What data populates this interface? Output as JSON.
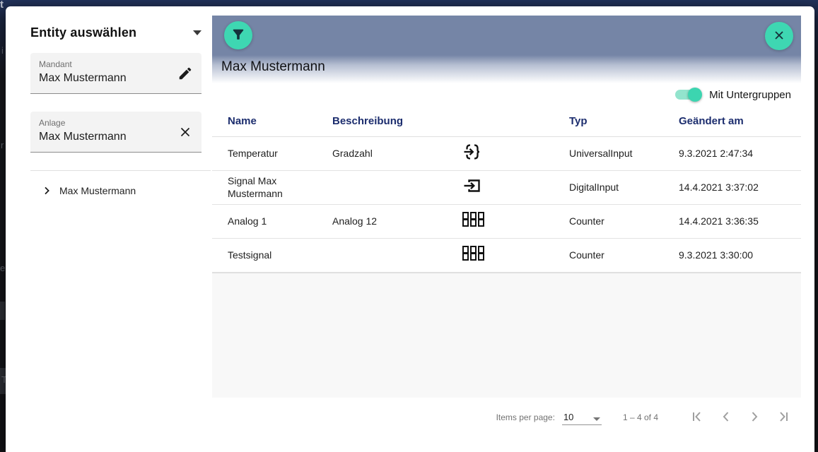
{
  "background_fragments": [
    "t",
    "i",
    "r",
    "el",
    "T"
  ],
  "colors": {
    "accent_teal": "#3ed7b2",
    "header_bar": "#7585a6",
    "table_header_text": "#1c2d6e",
    "overlay_background": "#15161a"
  },
  "sidebar": {
    "title": "Entity auswählen",
    "collapse_icon": "caret-down-icon",
    "fields": [
      {
        "label": "Mandant",
        "value": "Max Mustermann",
        "action_icon": "edit-pencil-icon"
      },
      {
        "label": "Anlage",
        "value": "Max Mustermann",
        "action_icon": "clear-x-icon"
      }
    ],
    "tree": [
      {
        "label": "Max Mustermann",
        "expand_icon": "chevron-right-icon"
      }
    ]
  },
  "main": {
    "filter_button_icon": "funnel-icon",
    "close_button_icon": "x-icon",
    "title": "Max Mustermann",
    "toggle": {
      "label": "Mit Untergruppen",
      "state": "on"
    },
    "table": {
      "columns": [
        "Name",
        "Beschreibung",
        "",
        "Typ",
        "Geändert am"
      ],
      "rows": [
        {
          "name": "Temperatur",
          "description": "Gradzahl",
          "icon": "input-braces-icon",
          "typ": "UniversalInput",
          "changed": "9.3.2021 2:47:34"
        },
        {
          "name": "Signal Max Mustermann",
          "description": "",
          "icon": "input-box-icon",
          "typ": "DigitalInput",
          "changed": "14.4.2021 3:37:02"
        },
        {
          "name": "Analog 1",
          "description": "Analog 12",
          "icon": "counter-888-icon",
          "typ": "Counter",
          "changed": "14.4.2021 3:36:35"
        },
        {
          "name": "Testsignal",
          "description": "",
          "icon": "counter-888-icon",
          "typ": "Counter",
          "changed": "9.3.2021 3:30:00"
        }
      ]
    },
    "paginator": {
      "items_per_page_label": "Items per page:",
      "items_per_page_value": "10",
      "range_label": "1 – 4 of 4",
      "nav": [
        "first-page-icon",
        "previous-page-icon",
        "next-page-icon",
        "last-page-icon"
      ]
    }
  }
}
